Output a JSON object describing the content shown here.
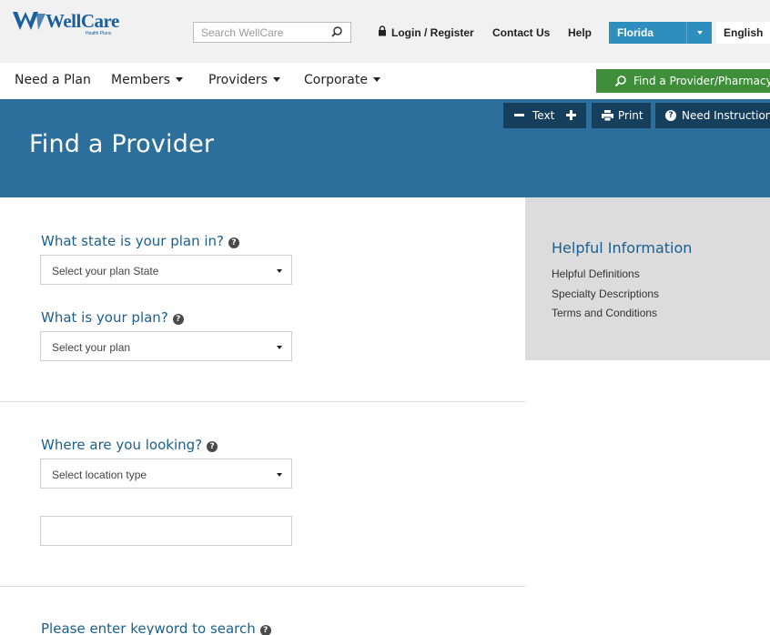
{
  "brand": {
    "name": "WellCare",
    "tagline": "Health Plans"
  },
  "utility": {
    "search_placeholder": "Search WellCare",
    "login": "Login / Register",
    "contact": "Contact Us",
    "help": "Help",
    "state": "Florida",
    "language": "English"
  },
  "nav": {
    "need_plan": "Need a Plan",
    "members": "Members",
    "providers": "Providers",
    "corporate": "Corporate",
    "find_button": "Find a Provider/Pharmacy"
  },
  "hero": {
    "title": "Find a Provider",
    "text_tool": "Text",
    "print": "Print",
    "instructions": "Need Instructions"
  },
  "form": {
    "state_question": "What state is your plan in?",
    "state_select": "Select your plan State",
    "plan_question": "What is your plan?",
    "plan_select": "Select your plan",
    "location_question": "Where are you looking?",
    "location_select": "Select location type",
    "location_value": "",
    "keyword_question": "Please enter keyword to search"
  },
  "panel": {
    "title": "Helpful Information",
    "links": [
      "Helpful Definitions",
      "Specialty Descriptions",
      "Terms and Conditions"
    ]
  },
  "colors": {
    "brand_blue": "#1a5fa0",
    "hero_blue": "#2d6f9c",
    "toolbar_dark": "#163f5d",
    "state_blue": "#2e8fbe",
    "find_green": "#3e8e3a",
    "heading_blue": "#1c5f8f"
  }
}
